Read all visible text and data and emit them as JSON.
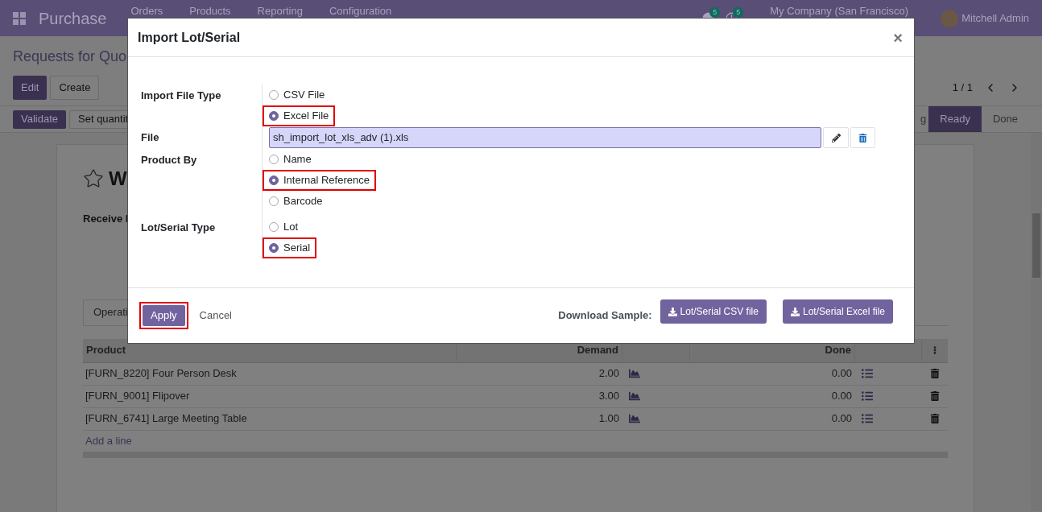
{
  "navbar": {
    "app_name": "Purchase",
    "menu": [
      "Orders",
      "Products",
      "Reporting",
      "Configuration"
    ],
    "badges": [
      "5",
      "5"
    ],
    "company": "My Company (San Francisco)",
    "user": "Mitchell Admin"
  },
  "breadcrumb": "Requests for Quo",
  "buttons": [
    "Edit",
    "Create"
  ],
  "pager": "1 / 1",
  "actions": [
    "Validate",
    "Set quantit"
  ],
  "status_bar": [
    {
      "label": "g",
      "selected": false
    },
    {
      "label": "Ready",
      "selected": true
    },
    {
      "label": "Done",
      "selected": false
    }
  ],
  "record": {
    "title": "W",
    "starred": false,
    "field_label": "Receive I",
    "tab": "Operati"
  },
  "table": {
    "columns": [
      "Product",
      "Demand",
      "Done"
    ],
    "rows": [
      {
        "product": "[FURN_8220] Four Person Desk",
        "demand": "2.00",
        "done": "0.00"
      },
      {
        "product": "[FURN_9001] Flipover",
        "demand": "3.00",
        "done": "0.00"
      },
      {
        "product": "[FURN_6741] Large Meeting Table",
        "demand": "1.00",
        "done": "0.00"
      }
    ],
    "add_line": "Add a line"
  },
  "dialog": {
    "title": "Import Lot/Serial",
    "close": "×",
    "fields": [
      {
        "label": "Import File Type",
        "kind": "radio",
        "options": [
          {
            "label": "CSV File",
            "selected": false,
            "highlighted": false
          },
          {
            "label": "Excel File",
            "selected": true,
            "highlighted": true
          }
        ]
      },
      {
        "label": "File",
        "kind": "file",
        "value": "sh_import_lot_xls_adv (1).xls"
      },
      {
        "label": "Product By",
        "kind": "radio",
        "options": [
          {
            "label": "Name",
            "selected": false,
            "highlighted": false
          },
          {
            "label": "Internal Reference",
            "selected": true,
            "highlighted": true
          },
          {
            "label": "Barcode",
            "selected": false,
            "highlighted": false
          }
        ]
      },
      {
        "label": "Lot/Serial Type",
        "kind": "radio",
        "options": [
          {
            "label": "Lot",
            "selected": false,
            "highlighted": false
          },
          {
            "label": "Serial",
            "selected": true,
            "highlighted": true
          }
        ]
      }
    ],
    "apply": {
      "label": "Apply",
      "highlighted": true
    },
    "cancel": "Cancel",
    "download_label": "Download Sample:",
    "downloads": [
      "Lot/Serial CSV file",
      "Lot/Serial Excel file"
    ]
  }
}
